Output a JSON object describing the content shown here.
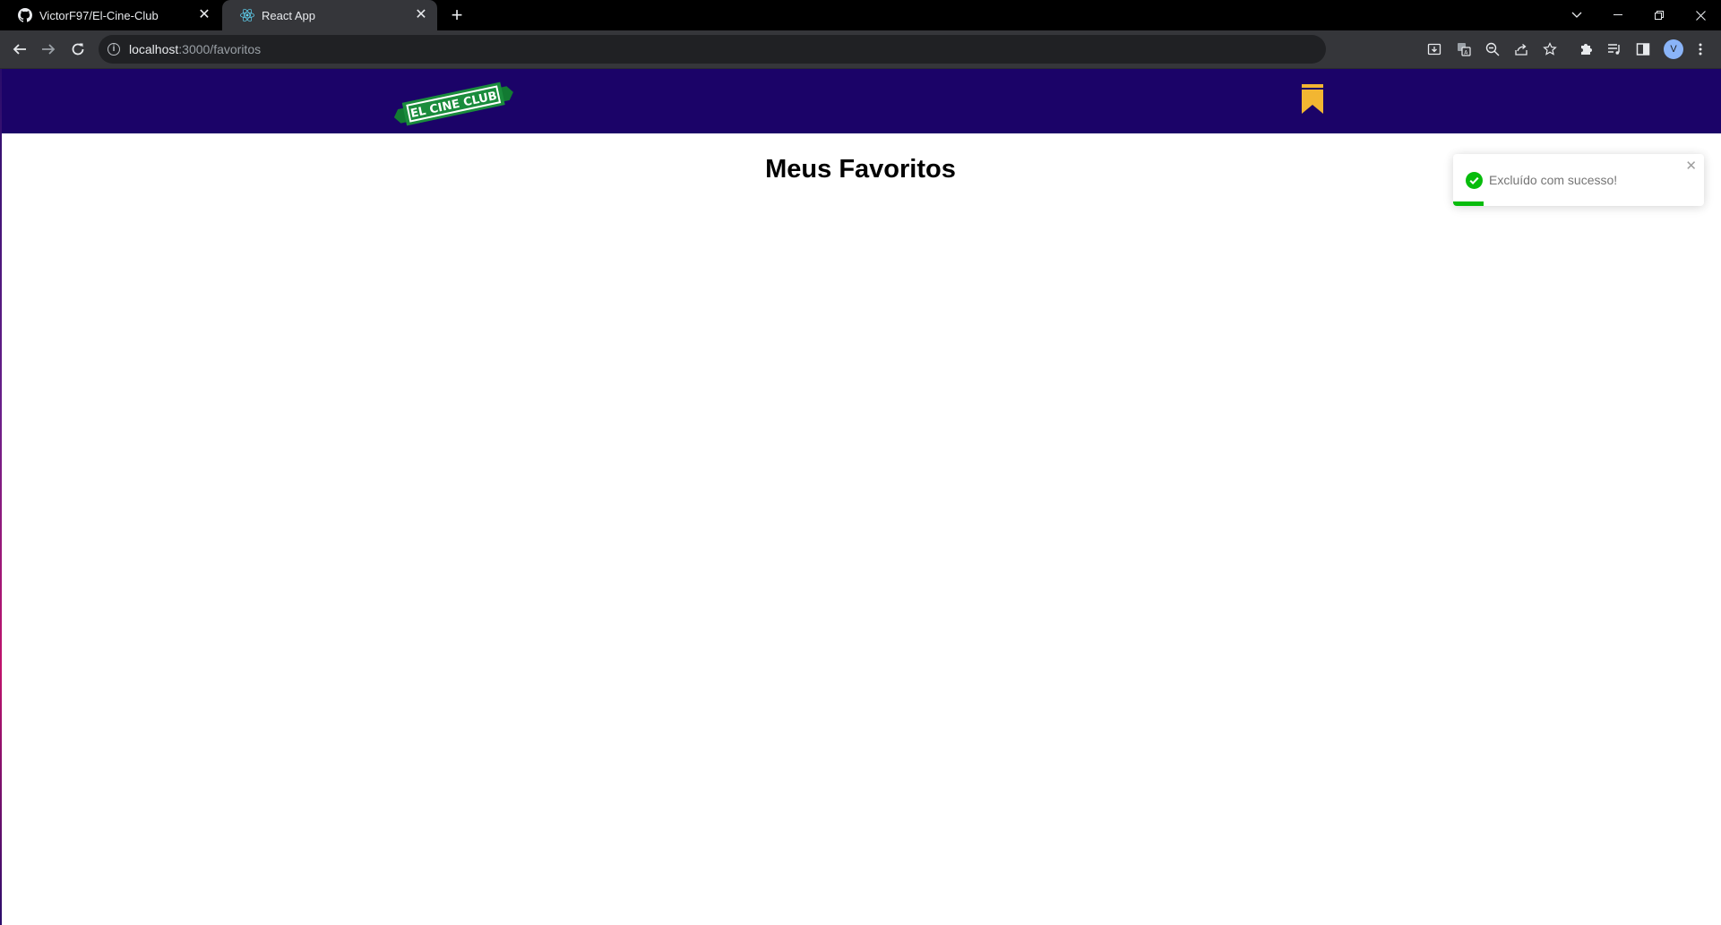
{
  "browser": {
    "tabs": [
      {
        "title": "VictorF97/El-Cine-Club",
        "icon": "github-icon",
        "active": false
      },
      {
        "title": "React App",
        "icon": "react-icon",
        "active": true
      }
    ],
    "new_tab_label": "+",
    "url_host": "localhost",
    "url_path": ":3000/favoritos",
    "avatar_initial": "V"
  },
  "app": {
    "logo_text": "EL CINE CLUB",
    "favorites_icon": "bookmark-icon",
    "page_title": "Meus Favoritos",
    "colors": {
      "navbar": "#1b0368",
      "bookmark": "#f2b632",
      "logo_green": "#1a8c3c",
      "toast_success": "#07bc0c"
    }
  },
  "toast": {
    "type": "success",
    "icon": "check-circle-icon",
    "message": "Excluído com sucesso!",
    "progress": 0.12
  }
}
